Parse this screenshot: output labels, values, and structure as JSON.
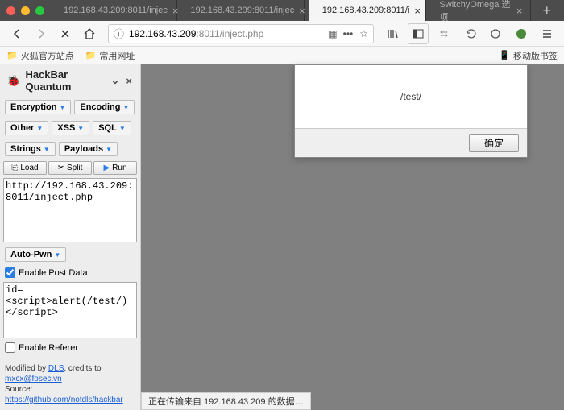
{
  "tabs": [
    {
      "label": "192.168.43.209:8011/injec"
    },
    {
      "label": "192.168.43.209:8011/injec"
    },
    {
      "label": "192.168.43.209:8011/i"
    },
    {
      "label": "SwitchyOmega 选项"
    }
  ],
  "url": {
    "host": "192.168.43.209",
    "rest": ":8011/inject.php"
  },
  "bookmarks": {
    "item1": "火狐官方站点",
    "item2": "常用网址",
    "mobile": "移动版书签"
  },
  "hackbar": {
    "title": "HackBar Quantum",
    "row1": {
      "encryption": "Encryption",
      "encoding": "Encoding"
    },
    "row2": {
      "other": "Other",
      "xss": "XSS",
      "sql": "SQL"
    },
    "row3": {
      "strings": "Strings",
      "payloads": "Payloads"
    },
    "actions": {
      "load": "Load",
      "split": "Split",
      "run": "Run"
    },
    "url_text": "http://192.168.43.209:8011/inject.php",
    "autopwn": "Auto-Pwn",
    "enable_post": "Enable Post Data",
    "post_text": "id=<script>alert(/test/)</script>",
    "enable_referer": "Enable Referer",
    "credits": {
      "line1a": "Modified by ",
      "dls": "DLS",
      "line1b": ", credits to ",
      "mx": "mxcx@fosec.vn",
      "line2a": "Source: ",
      "src": "https://github.com/notdls/hackbar"
    }
  },
  "dialog": {
    "message": "/test/",
    "ok": "确定"
  },
  "status": "正在传输来自 192.168.43.209 的数据…"
}
